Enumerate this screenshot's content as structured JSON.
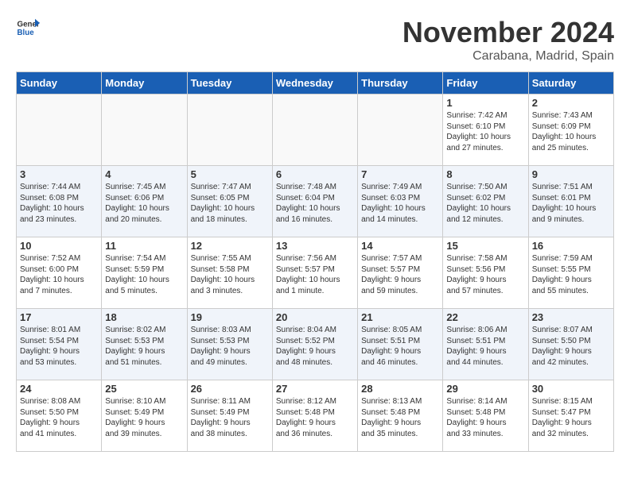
{
  "header": {
    "logo_line1": "General",
    "logo_line2": "Blue",
    "month_year": "November 2024",
    "location": "Carabana, Madrid, Spain"
  },
  "weekdays": [
    "Sunday",
    "Monday",
    "Tuesday",
    "Wednesday",
    "Thursday",
    "Friday",
    "Saturday"
  ],
  "weeks": [
    {
      "alt": false,
      "days": [
        {
          "date": "",
          "info": ""
        },
        {
          "date": "",
          "info": ""
        },
        {
          "date": "",
          "info": ""
        },
        {
          "date": "",
          "info": ""
        },
        {
          "date": "",
          "info": ""
        },
        {
          "date": "1",
          "info": "Sunrise: 7:42 AM\nSunset: 6:10 PM\nDaylight: 10 hours\nand 27 minutes."
        },
        {
          "date": "2",
          "info": "Sunrise: 7:43 AM\nSunset: 6:09 PM\nDaylight: 10 hours\nand 25 minutes."
        }
      ]
    },
    {
      "alt": true,
      "days": [
        {
          "date": "3",
          "info": "Sunrise: 7:44 AM\nSunset: 6:08 PM\nDaylight: 10 hours\nand 23 minutes."
        },
        {
          "date": "4",
          "info": "Sunrise: 7:45 AM\nSunset: 6:06 PM\nDaylight: 10 hours\nand 20 minutes."
        },
        {
          "date": "5",
          "info": "Sunrise: 7:47 AM\nSunset: 6:05 PM\nDaylight: 10 hours\nand 18 minutes."
        },
        {
          "date": "6",
          "info": "Sunrise: 7:48 AM\nSunset: 6:04 PM\nDaylight: 10 hours\nand 16 minutes."
        },
        {
          "date": "7",
          "info": "Sunrise: 7:49 AM\nSunset: 6:03 PM\nDaylight: 10 hours\nand 14 minutes."
        },
        {
          "date": "8",
          "info": "Sunrise: 7:50 AM\nSunset: 6:02 PM\nDaylight: 10 hours\nand 12 minutes."
        },
        {
          "date": "9",
          "info": "Sunrise: 7:51 AM\nSunset: 6:01 PM\nDaylight: 10 hours\nand 9 minutes."
        }
      ]
    },
    {
      "alt": false,
      "days": [
        {
          "date": "10",
          "info": "Sunrise: 7:52 AM\nSunset: 6:00 PM\nDaylight: 10 hours\nand 7 minutes."
        },
        {
          "date": "11",
          "info": "Sunrise: 7:54 AM\nSunset: 5:59 PM\nDaylight: 10 hours\nand 5 minutes."
        },
        {
          "date": "12",
          "info": "Sunrise: 7:55 AM\nSunset: 5:58 PM\nDaylight: 10 hours\nand 3 minutes."
        },
        {
          "date": "13",
          "info": "Sunrise: 7:56 AM\nSunset: 5:57 PM\nDaylight: 10 hours\nand 1 minute."
        },
        {
          "date": "14",
          "info": "Sunrise: 7:57 AM\nSunset: 5:57 PM\nDaylight: 9 hours\nand 59 minutes."
        },
        {
          "date": "15",
          "info": "Sunrise: 7:58 AM\nSunset: 5:56 PM\nDaylight: 9 hours\nand 57 minutes."
        },
        {
          "date": "16",
          "info": "Sunrise: 7:59 AM\nSunset: 5:55 PM\nDaylight: 9 hours\nand 55 minutes."
        }
      ]
    },
    {
      "alt": true,
      "days": [
        {
          "date": "17",
          "info": "Sunrise: 8:01 AM\nSunset: 5:54 PM\nDaylight: 9 hours\nand 53 minutes."
        },
        {
          "date": "18",
          "info": "Sunrise: 8:02 AM\nSunset: 5:53 PM\nDaylight: 9 hours\nand 51 minutes."
        },
        {
          "date": "19",
          "info": "Sunrise: 8:03 AM\nSunset: 5:53 PM\nDaylight: 9 hours\nand 49 minutes."
        },
        {
          "date": "20",
          "info": "Sunrise: 8:04 AM\nSunset: 5:52 PM\nDaylight: 9 hours\nand 48 minutes."
        },
        {
          "date": "21",
          "info": "Sunrise: 8:05 AM\nSunset: 5:51 PM\nDaylight: 9 hours\nand 46 minutes."
        },
        {
          "date": "22",
          "info": "Sunrise: 8:06 AM\nSunset: 5:51 PM\nDaylight: 9 hours\nand 44 minutes."
        },
        {
          "date": "23",
          "info": "Sunrise: 8:07 AM\nSunset: 5:50 PM\nDaylight: 9 hours\nand 42 minutes."
        }
      ]
    },
    {
      "alt": false,
      "days": [
        {
          "date": "24",
          "info": "Sunrise: 8:08 AM\nSunset: 5:50 PM\nDaylight: 9 hours\nand 41 minutes."
        },
        {
          "date": "25",
          "info": "Sunrise: 8:10 AM\nSunset: 5:49 PM\nDaylight: 9 hours\nand 39 minutes."
        },
        {
          "date": "26",
          "info": "Sunrise: 8:11 AM\nSunset: 5:49 PM\nDaylight: 9 hours\nand 38 minutes."
        },
        {
          "date": "27",
          "info": "Sunrise: 8:12 AM\nSunset: 5:48 PM\nDaylight: 9 hours\nand 36 minutes."
        },
        {
          "date": "28",
          "info": "Sunrise: 8:13 AM\nSunset: 5:48 PM\nDaylight: 9 hours\nand 35 minutes."
        },
        {
          "date": "29",
          "info": "Sunrise: 8:14 AM\nSunset: 5:48 PM\nDaylight: 9 hours\nand 33 minutes."
        },
        {
          "date": "30",
          "info": "Sunrise: 8:15 AM\nSunset: 5:47 PM\nDaylight: 9 hours\nand 32 minutes."
        }
      ]
    }
  ]
}
